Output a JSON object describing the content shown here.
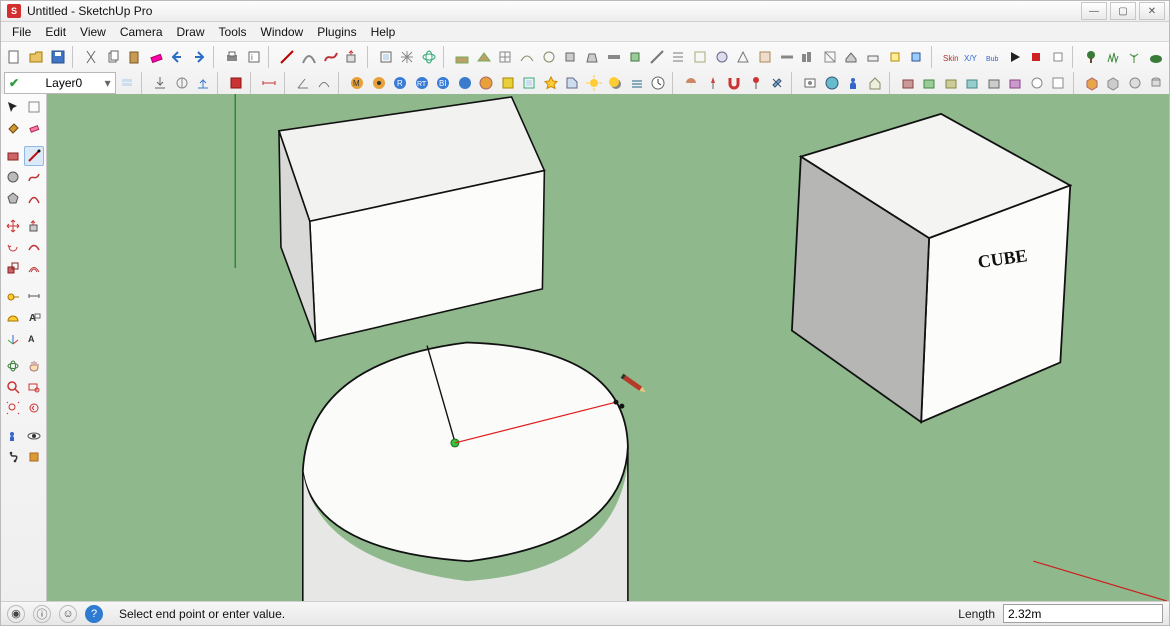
{
  "window": {
    "title": "Untitled - SketchUp Pro"
  },
  "winbuttons": {
    "min": "—",
    "max": "▢",
    "close": "✕"
  },
  "menus": [
    "File",
    "Edit",
    "View",
    "Camera",
    "Draw",
    "Tools",
    "Window",
    "Plugins",
    "Help"
  ],
  "layers": {
    "current": "Layer0"
  },
  "status": {
    "hint": "Select end point or enter value.",
    "length_label": "Length",
    "length_value": "2.32m"
  },
  "scene": {
    "cube_text": "CUBE"
  },
  "icons": {
    "geo": "◉",
    "info": "ⓘ",
    "user": "☺",
    "help": "?"
  }
}
